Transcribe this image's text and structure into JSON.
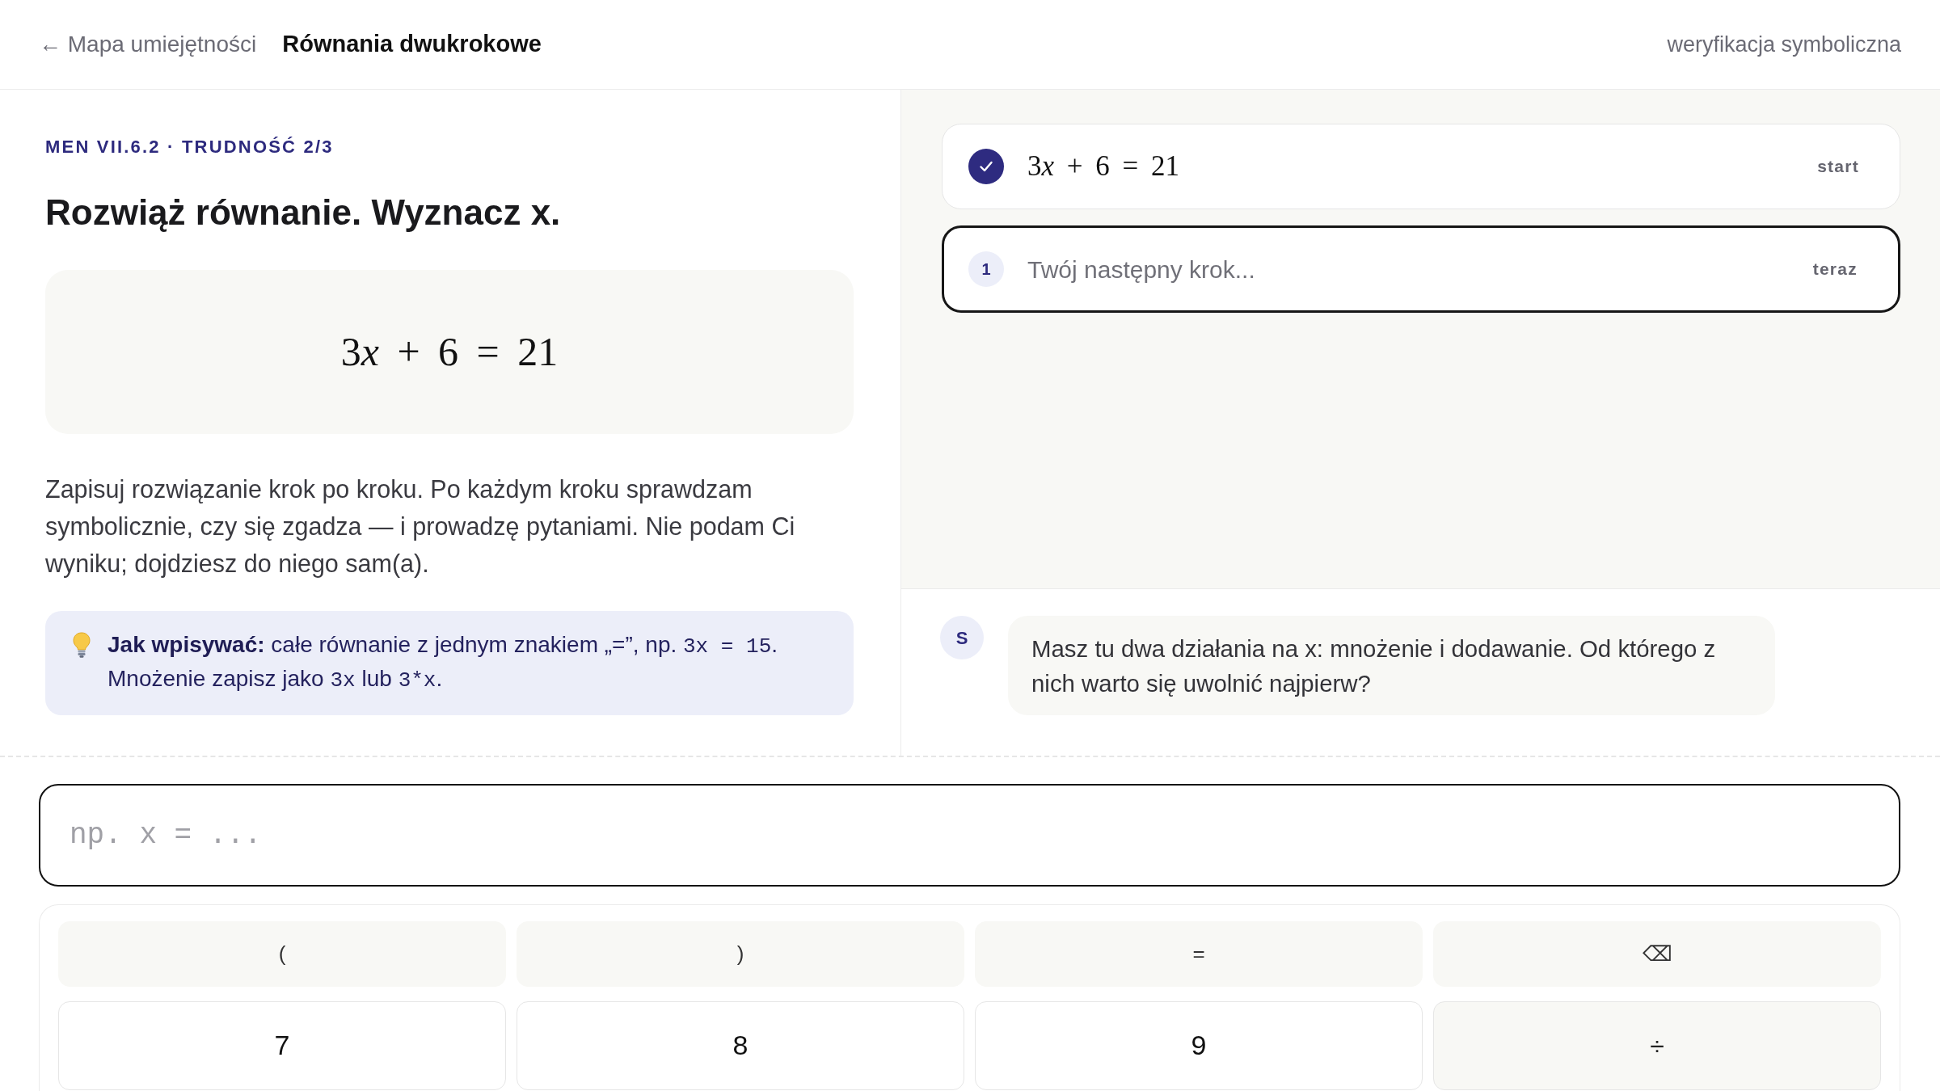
{
  "header": {
    "back_link": "← Mapa umiejętności",
    "title": "Równania dwukrokowe",
    "mode": "weryfikacja symboliczna"
  },
  "task": {
    "kicker": "MEN VII.6.2 · TRUDNOŚĆ 2/3",
    "heading": "Rozwiąż równanie. Wyznacz x.",
    "equation": "3x + 6 = 21",
    "instructions": "Zapisuj rozwiązanie krok po kroku. Po każdym kroku sprawdzam symbolicznie, czy się zgadza — i prowadzę pytaniami. Nie podam Ci wyniku; dojdziesz do niego sam(a).",
    "hint": {
      "label": "Jak wpisywać:",
      "parts": [
        {
          "kind": "text",
          "text": " całe równanie z jednym znakiem „=”, np. "
        },
        {
          "kind": "code",
          "text": "3x = 15"
        },
        {
          "kind": "text",
          "text": ". Mnożenie zapisz jako "
        },
        {
          "kind": "code",
          "text": "3x"
        },
        {
          "kind": "text",
          "text": " lub "
        },
        {
          "kind": "code",
          "text": "3*x"
        },
        {
          "kind": "text",
          "text": "."
        }
      ]
    }
  },
  "steps": [
    {
      "kind": "done",
      "expression": "3x + 6 = 21",
      "tag": "start"
    },
    {
      "kind": "current",
      "number": "1",
      "prompt": "Twój następny krok...",
      "tag": "teraz"
    }
  ],
  "chat": [
    {
      "avatar": "S",
      "text": "Masz tu dwa działania na x: mnożenie i dodawanie. Od którego z nich warto się uwolnić najpierw?"
    }
  ],
  "answer_input": {
    "placeholder": "np. x = ..."
  },
  "keypad": {
    "rows": [
      [
        {
          "label": "(",
          "kind": "symbol"
        },
        {
          "label": ")",
          "kind": "symbol"
        },
        {
          "label": "=",
          "kind": "symbol"
        },
        {
          "label": "⌫",
          "kind": "symbol"
        }
      ],
      [
        {
          "label": "7",
          "kind": "digit"
        },
        {
          "label": "8",
          "kind": "digit"
        },
        {
          "label": "9",
          "kind": "digit"
        },
        {
          "label": "÷",
          "kind": "operator"
        }
      ]
    ]
  }
}
